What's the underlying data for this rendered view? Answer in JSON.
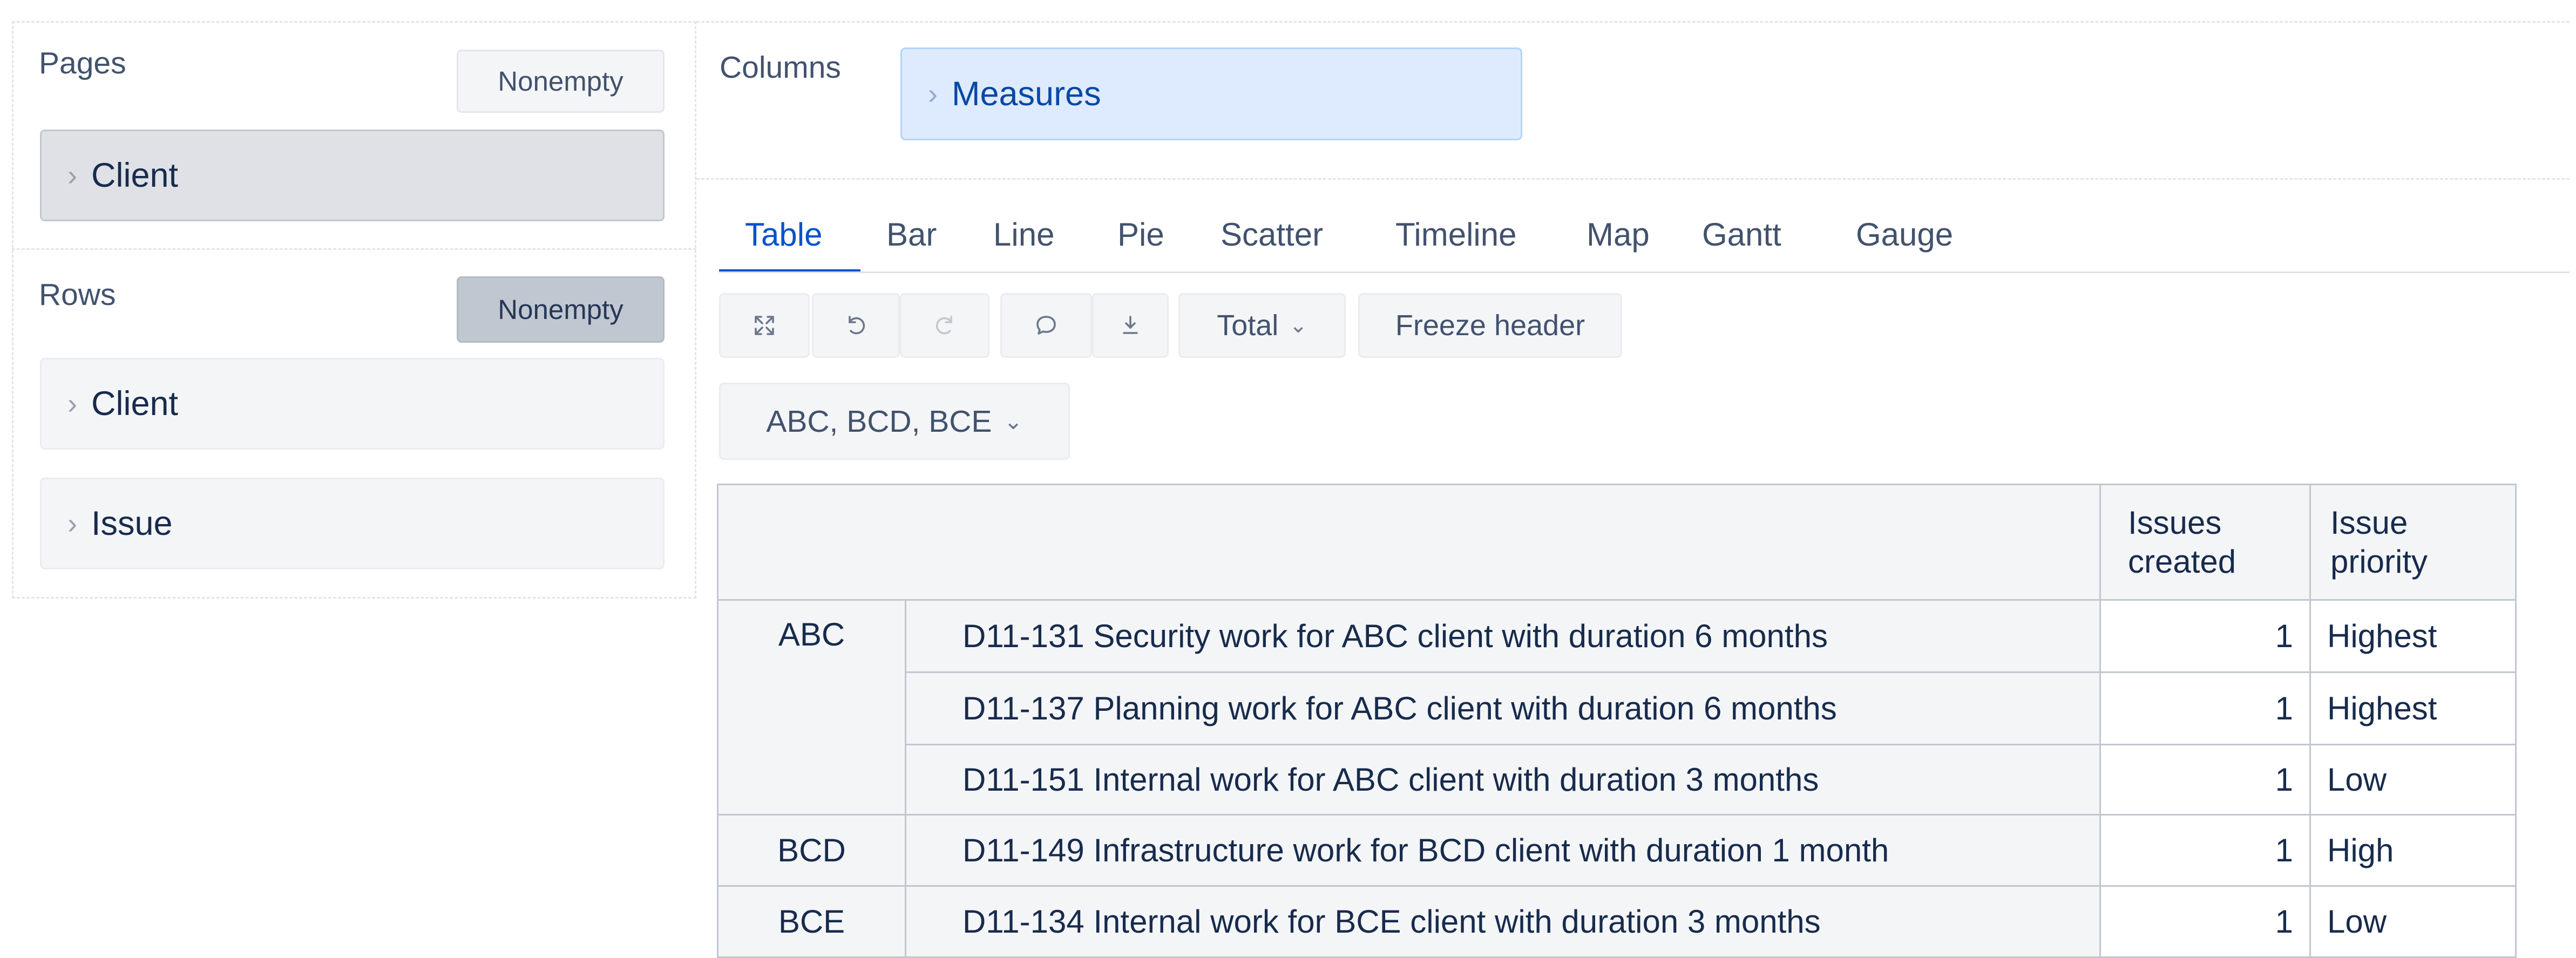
{
  "pages": {
    "title": "Pages",
    "nonempty_label": "Nonempty",
    "item": "Client"
  },
  "rows": {
    "title": "Rows",
    "nonempty_label": "Nonempty",
    "items": [
      "Client",
      "Issue"
    ]
  },
  "columns": {
    "title": "Columns",
    "item": "Measures"
  },
  "tabs": [
    "Table",
    "Bar",
    "Line",
    "Pie",
    "Scatter",
    "Timeline",
    "Map",
    "Gantt",
    "Gauge"
  ],
  "active_tab": "Table",
  "toolbar": {
    "icons": [
      "fullscreen-icon",
      "undo-icon",
      "redo-icon",
      "comment-icon",
      "export-icon"
    ],
    "total_label": "Total",
    "freeze_label": "Freeze header"
  },
  "filter": {
    "label": "ABC, BCD, BCE"
  },
  "table": {
    "columns": [
      {
        "line1": "Issues",
        "line2": "created"
      },
      {
        "line1": "Issue",
        "line2": "priority"
      }
    ],
    "groups": [
      {
        "client": "ABC",
        "rows": [
          {
            "issue": "D11-131 Security work for ABC client with duration 6 months",
            "created": "1",
            "priority": "Highest"
          },
          {
            "issue": "D11-137 Planning work for ABC client with duration 6 months",
            "created": "1",
            "priority": "Highest"
          },
          {
            "issue": "D11-151 Internal work for ABC client with duration 3 months",
            "created": "1",
            "priority": "Low"
          }
        ]
      },
      {
        "client": "BCD",
        "rows": [
          {
            "issue": "D11-149 Infrastructure work for BCD client with duration 1 month",
            "created": "1",
            "priority": "High"
          }
        ]
      },
      {
        "client": "BCE",
        "rows": [
          {
            "issue": "D11-134 Internal work for BCE client with duration 3 months",
            "created": "1",
            "priority": "Low"
          }
        ]
      }
    ]
  },
  "colors": {
    "accent": "#0052cc",
    "measures_bg": "#deebff",
    "border": "#c1c7d0"
  }
}
